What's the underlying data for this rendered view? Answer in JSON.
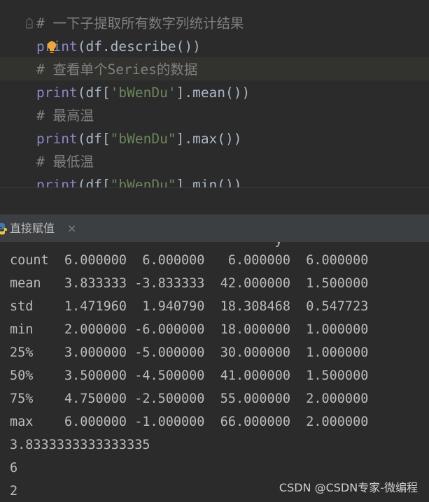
{
  "editor": {
    "lines": [
      {
        "comment": "# 一下子提取所有数字列统计结果"
      },
      {
        "fn": "print",
        "open": "(",
        "args": "df.describe()",
        "close": ")"
      },
      {
        "comment": "# 查看单个Series的数据"
      },
      {
        "fn": "print",
        "open": "(df[",
        "str": "'bWenDu'",
        "rest": "].mean())"
      },
      {
        "comment": "# 最高温"
      },
      {
        "fn": "print",
        "open": "(df[",
        "str": "\"bWenDu\"",
        "rest": "].max())"
      },
      {
        "comment": "# 最低温"
      },
      {
        "fn": "print",
        "open": "(df[",
        "str": "\"bWenDu\"",
        "rest": "].min())"
      }
    ]
  },
  "run_panel": {
    "tab_label": "直接赋值",
    "close_glyph": "×"
  },
  "console": {
    "header_fragment": "                                  y                       p        p",
    "describe_rows": [
      "count  6.000000  6.000000   6.000000  6.000000",
      "mean   3.833333 -3.833333  42.000000  1.500000",
      "std    1.471960  1.940790  18.308468  0.547723",
      "min    2.000000 -6.000000  18.000000  1.000000",
      "25%    3.000000 -5.000000  30.000000  1.000000",
      "50%    3.500000 -4.500000  41.000000  1.500000",
      "75%    4.750000 -2.500000  55.000000  2.000000",
      "max    6.000000 -1.000000  66.000000  2.000000"
    ],
    "mean_result": "3.8333333333333335",
    "max_result": "6",
    "min_result": "2"
  },
  "watermark": "CSDN @CSDN专家-微编程",
  "colors": {
    "background": "#2b2b2b",
    "comment": "#808080",
    "builtin": "#8888c6",
    "string": "#6a8759",
    "text": "#a9b7c6",
    "console_text": "#bbbbbb"
  }
}
